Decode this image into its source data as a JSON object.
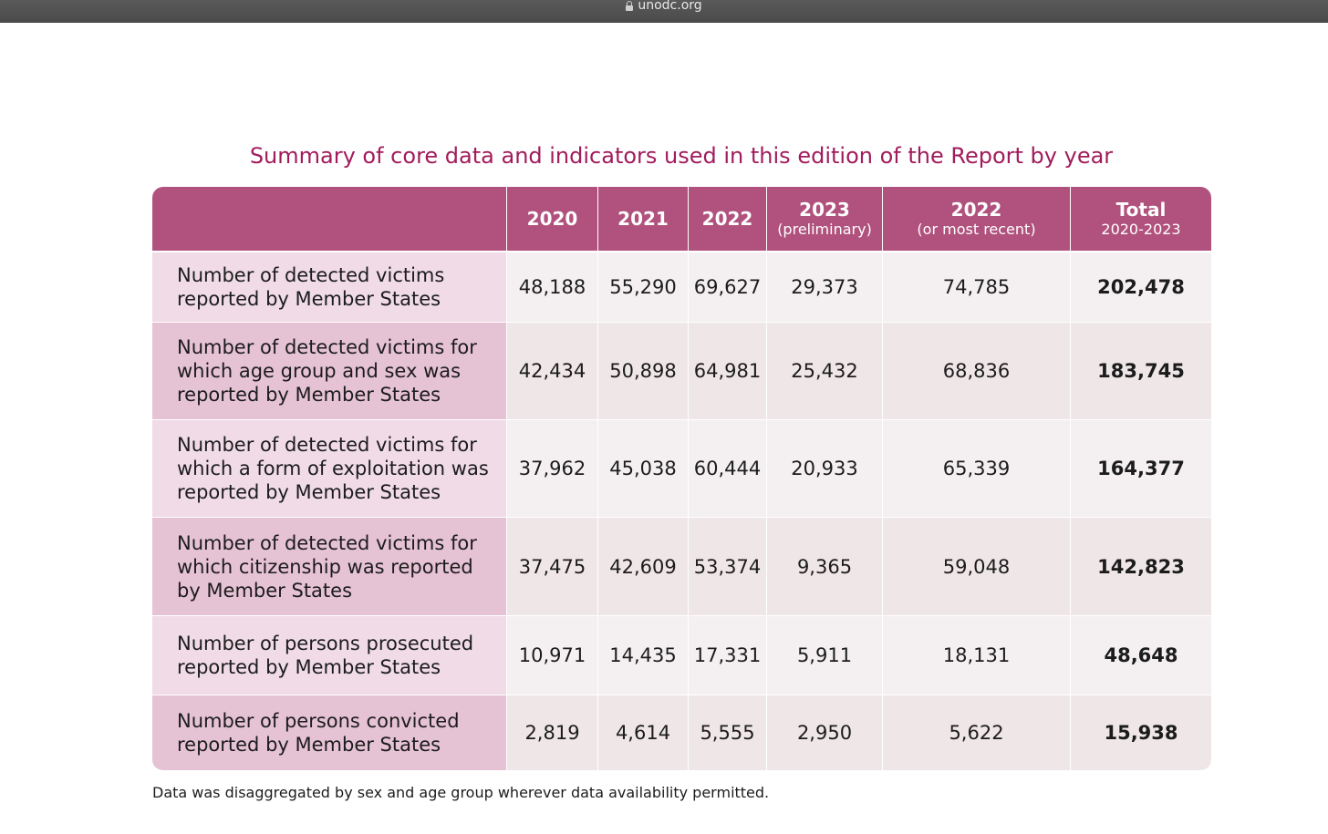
{
  "browser": {
    "url": "unodc.org",
    "lock_icon": "lock-icon"
  },
  "title": "Summary of core data and indicators used in this edition of the Report by year",
  "table": {
    "headers": [
      {
        "main": "",
        "sub": ""
      },
      {
        "main": "2020",
        "sub": ""
      },
      {
        "main": "2021",
        "sub": ""
      },
      {
        "main": "2022",
        "sub": ""
      },
      {
        "main": "2023",
        "sub": "(preliminary)"
      },
      {
        "main": "2022",
        "sub": "(or most recent)"
      },
      {
        "main": "Total",
        "sub": "2020-2023"
      }
    ],
    "rows": [
      {
        "label": "Number of detected victims reported by Member States",
        "values": [
          "48,188",
          "55,290",
          "69,627",
          "29,373",
          "74,785",
          "202,478"
        ]
      },
      {
        "label": "Number of detected victims for which age group and sex was reported by Member States",
        "values": [
          "42,434",
          "50,898",
          "64,981",
          "25,432",
          "68,836",
          "183,745"
        ]
      },
      {
        "label": "Number of detected victims for which a form of exploitation was reported by Member States",
        "values": [
          "37,962",
          "45,038",
          "60,444",
          "20,933",
          "65,339",
          "164,377"
        ]
      },
      {
        "label": "Number of detected victims for which citizenship was reported by Member States",
        "values": [
          "37,475",
          "42,609",
          "53,374",
          "9,365",
          "59,048",
          "142,823"
        ]
      },
      {
        "label": "Number of persons prosecuted reported by Member States",
        "values": [
          "10,971",
          "14,435",
          "17,331",
          "5,911",
          "18,131",
          "48,648"
        ]
      },
      {
        "label": "Number of persons convicted reported by Member States",
        "values": [
          "2,819",
          "4,614",
          "5,555",
          "2,950",
          "5,622",
          "15,938"
        ]
      }
    ]
  },
  "footnote": "Data was disaggregated by sex and age group wherever data availability permitted.",
  "colors": {
    "title": "#a11c5c",
    "header_bg": "#b0527d",
    "label_odd": "#f0dbe7",
    "label_even": "#e6c2d5"
  }
}
